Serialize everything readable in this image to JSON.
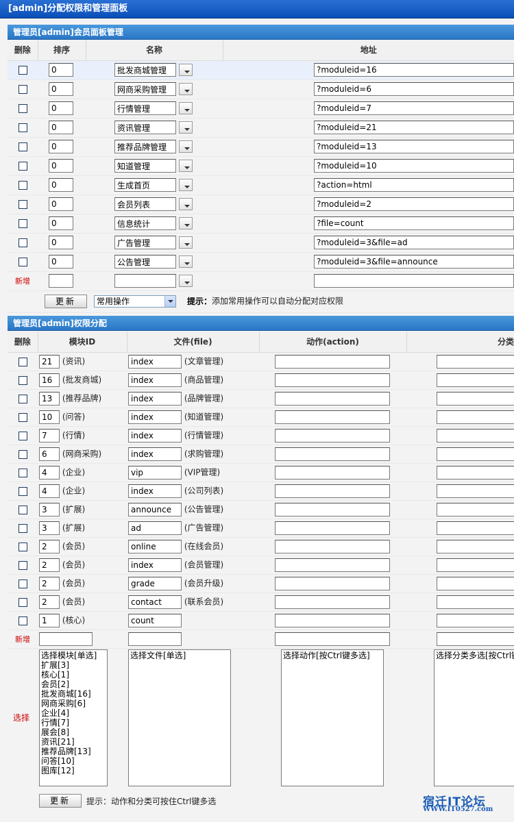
{
  "page_title": "[admin]分配权限和管理面板",
  "panel": {
    "title": "管理员[admin]会员面板管理",
    "headers": {
      "delete": "删除",
      "order": "排序",
      "name": "名称",
      "address": "地址"
    },
    "rows": [
      {
        "order": "0",
        "name": "批发商城管理",
        "address": "?moduleid=16"
      },
      {
        "order": "0",
        "name": "网商采购管理",
        "address": "?moduleid=6"
      },
      {
        "order": "0",
        "name": "行情管理",
        "address": "?moduleid=7"
      },
      {
        "order": "0",
        "name": "资讯管理",
        "address": "?moduleid=21"
      },
      {
        "order": "0",
        "name": "推荐品牌管理",
        "address": "?moduleid=13"
      },
      {
        "order": "0",
        "name": "知道管理",
        "address": "?moduleid=10"
      },
      {
        "order": "0",
        "name": "生成首页",
        "address": "?action=html"
      },
      {
        "order": "0",
        "name": "会员列表",
        "address": "?moduleid=2"
      },
      {
        "order": "0",
        "name": "信息统计",
        "address": "?file=count"
      },
      {
        "order": "0",
        "name": "广告管理",
        "address": "?moduleid=3&file=ad"
      },
      {
        "order": "0",
        "name": "公告管理",
        "address": "?moduleid=3&file=announce"
      }
    ],
    "new_label": "新增",
    "update_button": "更新",
    "common_select": "常用操作",
    "hint_label": "提示：",
    "hint_text": "添加常用操作可以自动分配对应权限"
  },
  "perm": {
    "title": "管理员[admin]权限分配",
    "headers": {
      "delete": "删除",
      "module": "模块ID",
      "file": "文件(file)",
      "action": "动作(action)",
      "category": "分类"
    },
    "rows": [
      {
        "mid": "21",
        "mname": "(资讯)",
        "file": "index",
        "fname": "(文章管理)"
      },
      {
        "mid": "16",
        "mname": "(批发商城)",
        "file": "index",
        "fname": "(商品管理)"
      },
      {
        "mid": "13",
        "mname": "(推荐品牌)",
        "file": "index",
        "fname": "(品牌管理)"
      },
      {
        "mid": "10",
        "mname": "(问答)",
        "file": "index",
        "fname": "(知道管理)"
      },
      {
        "mid": "7",
        "mname": "(行情)",
        "file": "index",
        "fname": "(行情管理)"
      },
      {
        "mid": "6",
        "mname": "(网商采购)",
        "file": "index",
        "fname": "(求购管理)"
      },
      {
        "mid": "4",
        "mname": "(企业)",
        "file": "vip",
        "fname": "(VIP管理)"
      },
      {
        "mid": "4",
        "mname": "(企业)",
        "file": "index",
        "fname": "(公司列表)"
      },
      {
        "mid": "3",
        "mname": "(扩展)",
        "file": "announce",
        "fname": "(公告管理)"
      },
      {
        "mid": "3",
        "mname": "(扩展)",
        "file": "ad",
        "fname": "(广告管理)"
      },
      {
        "mid": "2",
        "mname": "(会员)",
        "file": "online",
        "fname": "(在线会员)"
      },
      {
        "mid": "2",
        "mname": "(会员)",
        "file": "index",
        "fname": "(会员管理)"
      },
      {
        "mid": "2",
        "mname": "(会员)",
        "file": "grade",
        "fname": "(会员升级)"
      },
      {
        "mid": "2",
        "mname": "(会员)",
        "file": "contact",
        "fname": "(联系会员)"
      },
      {
        "mid": "1",
        "mname": "(核心)",
        "file": "count",
        "fname": ""
      }
    ],
    "new_label": "新增",
    "select_label": "选择",
    "module_list": [
      "选择模块[单选]",
      "扩展[3]",
      "核心[1]",
      "会员[2]",
      "批发商城[16]",
      "网商采购[6]",
      "企业[4]",
      "行情[7]",
      "展会[8]",
      "资讯[21]",
      "推荐品牌[13]",
      "问答[10]",
      "图库[12]"
    ],
    "file_list": [
      "选择文件[单选]"
    ],
    "action_list": [
      "选择动作[按Ctrl键多选]"
    ],
    "category_list": [
      "选择分类多选[按Ctrl键"
    ],
    "update_button": "更新",
    "hint": "提示：动作和分类可按住Ctrl键多选"
  },
  "watermark": {
    "line1": "宿迁IT论坛",
    "line2": "WWW.IT0527.com"
  }
}
